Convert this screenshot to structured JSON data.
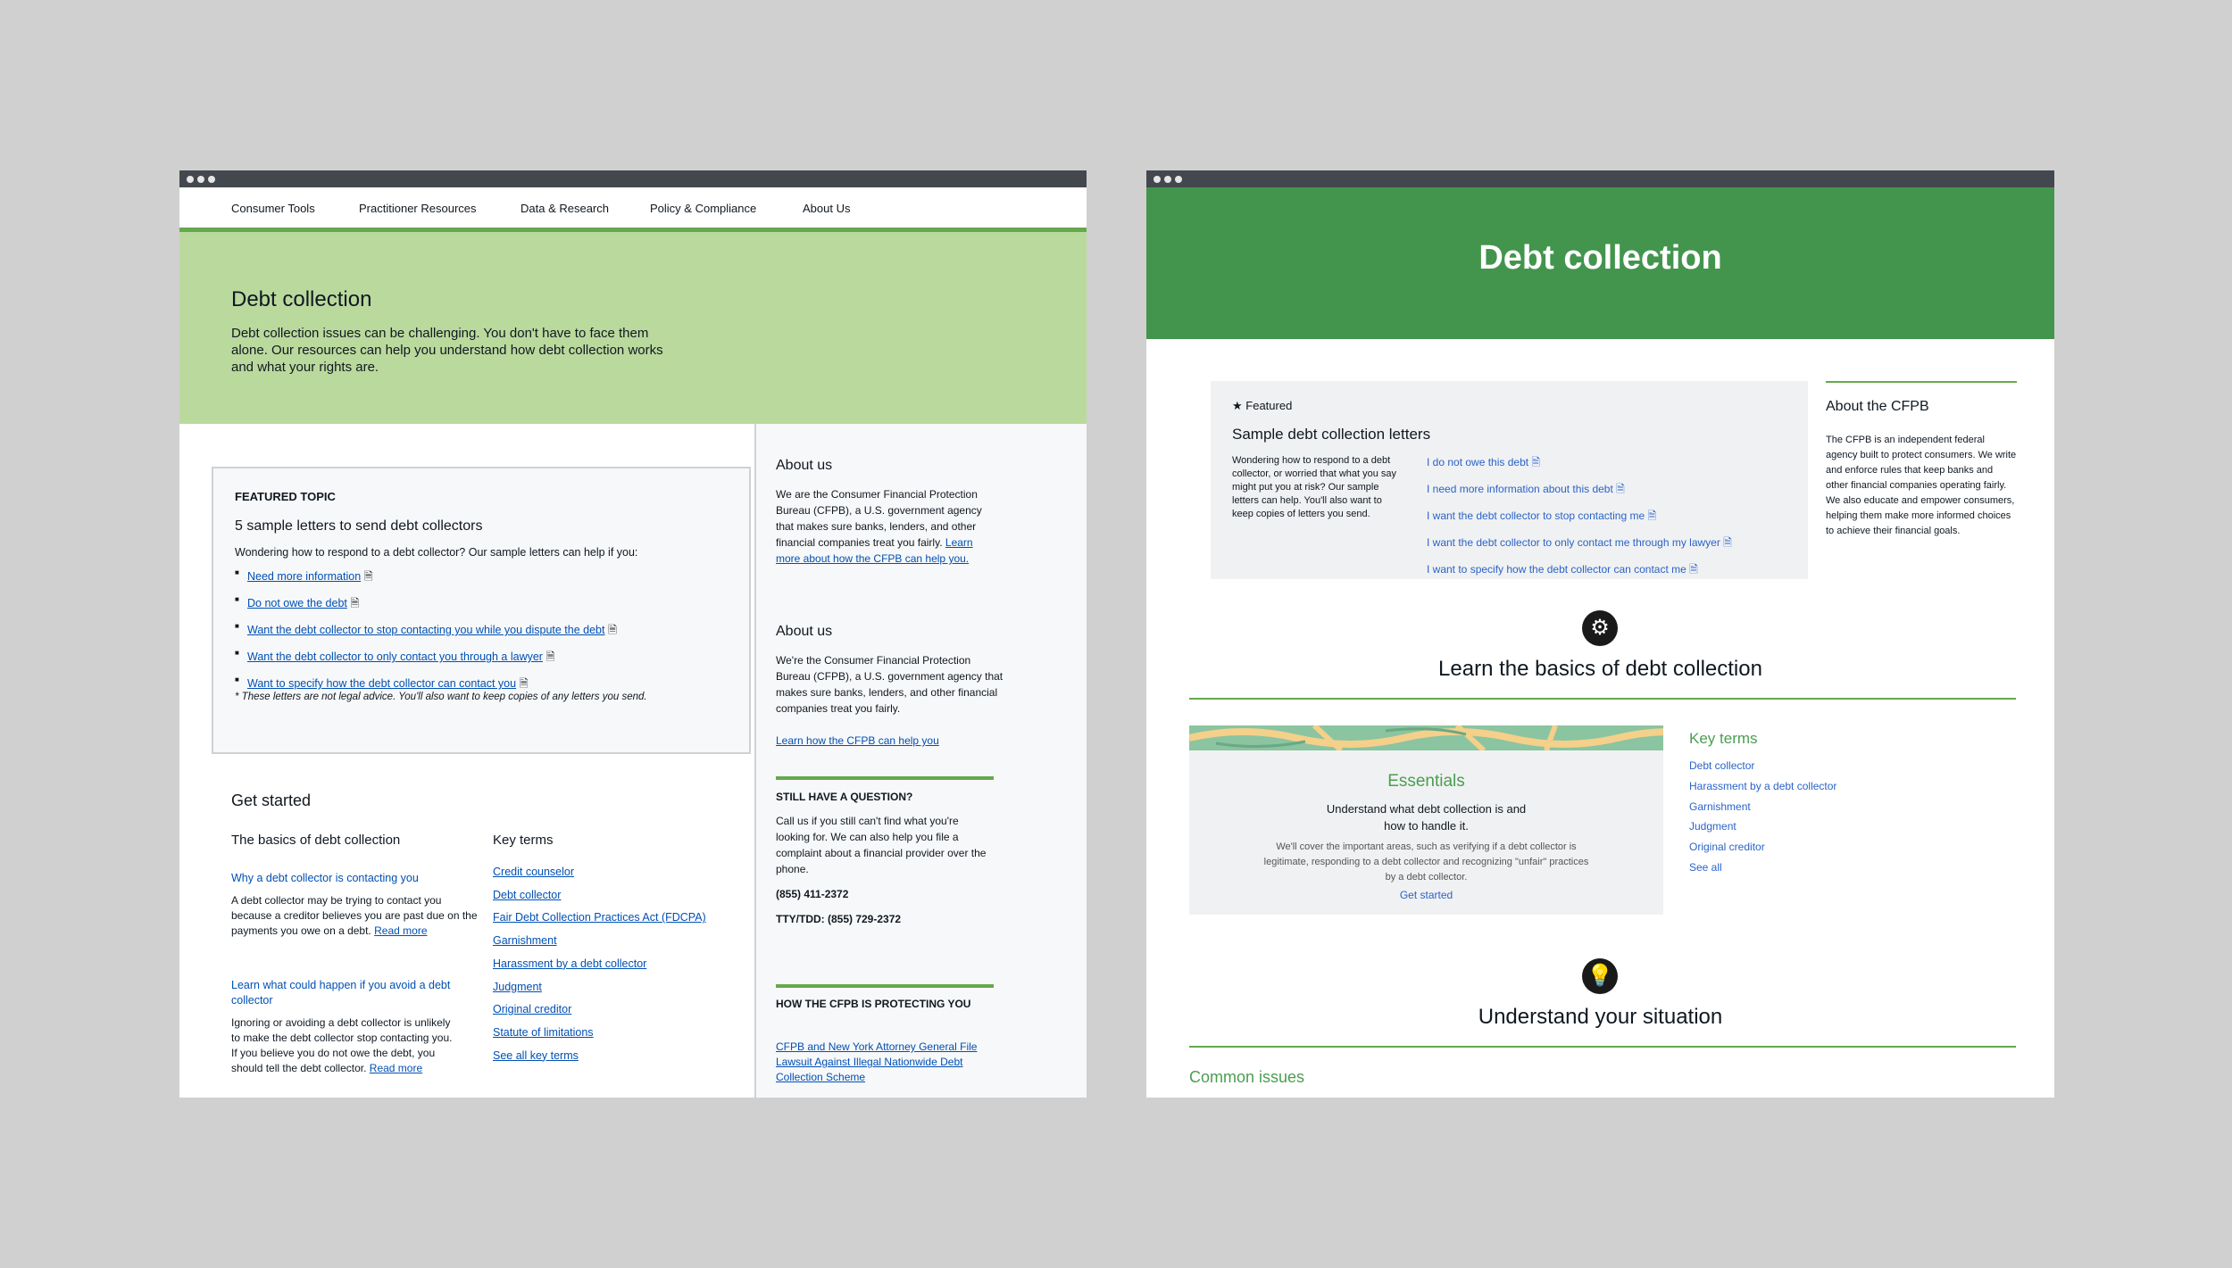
{
  "left": {
    "nav": [
      "Consumer Tools",
      "Practitioner Resources",
      "Data & Research",
      "Policy & Compliance",
      "About Us"
    ],
    "hero": {
      "title": "Debt collection",
      "text": "Debt collection issues can be challenging. You don't have to face them alone. Our resources can help you understand how debt collection works and what your rights are."
    },
    "featured": {
      "label": "FEATURED TOPIC",
      "heading": "5 sample letters to send debt collectors",
      "intro": "Wondering how to respond to a debt collector? Our sample letters can help if you:",
      "links": [
        "Need more information",
        "Do not owe the debt",
        "Want the debt collector to stop contacting you while you dispute the debt",
        "Want the debt collector to only contact you through a lawyer",
        "Want to specify how the debt collector can contact you"
      ],
      "note": "* These letters are not legal advice. You'll also want to keep copies of any letters you send."
    },
    "get_started": {
      "title": "Get started",
      "basics_title": "The basics of debt collection",
      "item1_link": "Why a debt collector is contacting you",
      "item1_text": "A debt collector may be trying to contact you because a creditor believes you are past due on the payments you owe on a debt.",
      "read_more": "Read more",
      "item2_link": "Learn what could happen if you avoid a debt collector",
      "item2_text": "Ignoring or avoiding a debt collector is unlikely to make the debt collector stop contacting you. If you believe you do not owe the debt, you should tell the debt collector.",
      "key_terms_title": "Key terms",
      "key_terms": [
        "Credit counselor",
        "Debt collector",
        "Fair Debt Collection Practices Act (FDCPA)",
        "Garnishment",
        "Harassment by a debt collector",
        "Judgment",
        "Original creditor",
        "Statute of limitations",
        "See all key terms"
      ]
    },
    "sidebar": {
      "about1_title": "About us",
      "about1_text": "We are the Consumer Financial Protection Bureau (CFPB), a U.S. government agency that makes sure banks, lenders, and other financial companies treat you fairly.",
      "about1_link": "Learn more about how the CFPB can help you.",
      "about2_title": "About us",
      "about2_text": "We're the Consumer Financial Protection Bureau (CFPB), a U.S. government agency that makes sure banks, lenders, and other financial companies treat you fairly.",
      "about2_link": "Learn how the CFPB can help you",
      "question_title": "STILL HAVE A QUESTION?",
      "question_text": "Call us if you still can't find what you're looking for. We can also help you file a complaint about a financial provider over the phone.",
      "phone": "(855) 411-2372",
      "tty": "TTY/TDD: (855) 729-2372",
      "protect_title": "HOW THE CFPB IS PROTECTING YOU",
      "protect_link": "CFPB and New York Attorney General File Lawsuit Against Illegal Nationwide Debt Collection Scheme"
    }
  },
  "right": {
    "hero_title": "Debt collection",
    "featured": {
      "label": "Featured",
      "heading": "Sample debt collection letters",
      "text": "Wondering how to respond to a debt collector, or worried that what you say might put you at risk? Our sample letters can help. You'll also want to keep copies of letters you send.",
      "links": [
        "I do not owe this debt",
        "I need more information about this debt",
        "I want the debt collector to stop contacting me",
        "I want the debt collector to only contact me through my lawyer",
        "I want to specify how the debt collector can contact me"
      ]
    },
    "about": {
      "title": "About the CFPB",
      "text": "The CFPB is an independent federal agency built to protect consumers. We write and enforce rules that keep banks and other financial companies operating fairly. We also educate and empower consumers, helping them make more informed choices to achieve their financial goals."
    },
    "learn_title": "Learn the basics of debt collection",
    "essentials": {
      "title": "Essentials",
      "subtitle": "Understand what debt collection is and how to handle it.",
      "text": "We'll cover the important areas, such as verifying if a debt collector is legitimate, responding to a debt collector and recognizing \"unfair\" practices by a debt collector.",
      "link": "Get started"
    },
    "key_terms_title": "Key terms",
    "key_terms": [
      "Debt collector",
      "Harassment by a debt collector",
      "Garnishment",
      "Judgment",
      "Original creditor",
      "See all"
    ],
    "situation_title": "Understand your situation",
    "common_issues": "Common issues"
  },
  "colors": {
    "green_light": "#bad99d",
    "green_dark": "#43954d",
    "accent_line": "#66a84e",
    "link": "#0050b4"
  }
}
